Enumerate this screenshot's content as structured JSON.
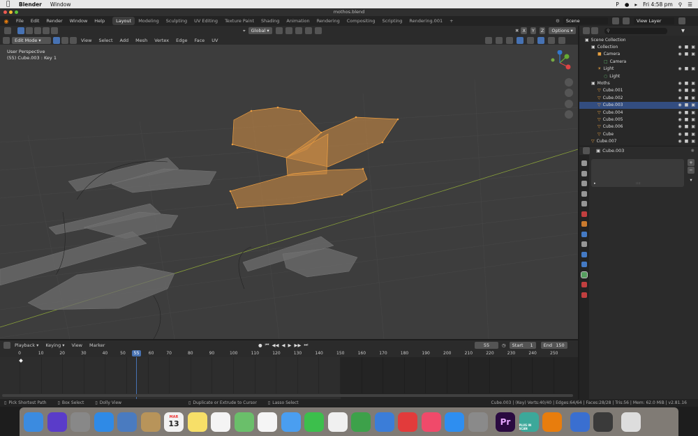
{
  "macos": {
    "app_name": "Blender",
    "menu": [
      "Window"
    ],
    "clock": "Fri 4:58 pm"
  },
  "window": {
    "title": "mothos.blend"
  },
  "topbar": {
    "menus": [
      "File",
      "Edit",
      "Render",
      "Window",
      "Help"
    ],
    "workspaces": [
      "Layout",
      "Modeling",
      "Sculpting",
      "UV Editing",
      "Texture Paint",
      "Shading",
      "Animation",
      "Rendering",
      "Compositing",
      "Scripting",
      "Rendering.001"
    ],
    "active_workspace": "Layout",
    "add_tab": "+",
    "scene_label": "Scene",
    "view_layer_label": "View Layer"
  },
  "viewport_header": {
    "transform_orientation": "Global",
    "options_label": "Options",
    "axes": [
      "X",
      "Y",
      "Z"
    ],
    "mode": "Edit Mode",
    "menus": [
      "View",
      "Select",
      "Add",
      "Mesh",
      "Vertex",
      "Edge",
      "Face",
      "UV"
    ]
  },
  "viewport": {
    "perspective": "User Perspective",
    "object_info": "(55) Cube.003 : Key 1",
    "gizmo": {
      "x": "X",
      "y": "Y",
      "z": "Z"
    },
    "colors": {
      "selected_mesh": "#e89a3a",
      "grid_x_axis": "#8aa23a",
      "background": "#3d3d3d"
    }
  },
  "outliner": {
    "root": "Scene Collection",
    "items": [
      {
        "name": "Collection",
        "indent": 1,
        "icon": "collection-icon"
      },
      {
        "name": "Camera",
        "indent": 2,
        "icon": "camera-icon"
      },
      {
        "name": "Camera",
        "indent": 3,
        "icon": "camera-data-icon"
      },
      {
        "name": "Light",
        "indent": 2,
        "icon": "light-icon"
      },
      {
        "name": "Light",
        "indent": 3,
        "icon": "light-data-icon"
      },
      {
        "name": "Moths",
        "indent": 1,
        "icon": "collection-icon"
      },
      {
        "name": "Cube.001",
        "indent": 2,
        "icon": "mesh-icon"
      },
      {
        "name": "Cube.002",
        "indent": 2,
        "icon": "mesh-icon"
      },
      {
        "name": "Cube.003",
        "indent": 2,
        "icon": "mesh-icon",
        "selected": true
      },
      {
        "name": "Cube.004",
        "indent": 2,
        "icon": "mesh-icon"
      },
      {
        "name": "Cube.005",
        "indent": 2,
        "icon": "mesh-icon"
      },
      {
        "name": "Cube.006",
        "indent": 2,
        "icon": "mesh-icon"
      },
      {
        "name": "Cube",
        "indent": 2,
        "icon": "mesh-icon"
      },
      {
        "name": "Cube.007",
        "indent": 1,
        "icon": "mesh-icon"
      }
    ]
  },
  "properties": {
    "object_name": "Cube.003"
  },
  "timeline": {
    "menus": [
      "Playback",
      "Keying",
      "View",
      "Marker"
    ],
    "current_frame": "55",
    "start_label": "Start",
    "start": "1",
    "end_label": "End",
    "end": "150",
    "ticks": [
      "0",
      "10",
      "20",
      "30",
      "40",
      "50",
      "60",
      "70",
      "80",
      "90",
      "100",
      "110",
      "120",
      "130",
      "140",
      "150",
      "160",
      "170",
      "180",
      "190",
      "200",
      "210",
      "220",
      "230",
      "240",
      "250"
    ]
  },
  "statusbar": {
    "left": [
      {
        "icon": "mouse-left-icon",
        "text": "Pick Shortest Path"
      },
      {
        "icon": "mouse-left-icon",
        "text": "Box Select"
      },
      {
        "icon": "mouse-middle-icon",
        "text": "Dolly View"
      },
      {
        "icon": "mouse-right-icon",
        "text": "Duplicate or Extrude to Cursor"
      },
      {
        "icon": "mouse-right-icon",
        "text": "Lasso Select"
      }
    ],
    "right": "Cube.003 | (Key) Verts:40/40 | Edges:64/64 | Faces:28/28 | Tris:56 | Mem: 62.0 MiB | v2.81.16"
  },
  "dock": {
    "calendar_month": "MAR",
    "calendar_day": "13",
    "apps": [
      {
        "name": "finder-icon",
        "color": "#3b8be0"
      },
      {
        "name": "siri-icon",
        "color": "#5a3cc9"
      },
      {
        "name": "launchpad-icon",
        "color": "#888"
      },
      {
        "name": "safari-icon",
        "color": "#2f8ae6"
      },
      {
        "name": "mail-icon",
        "color": "#4a7bc0"
      },
      {
        "name": "contacts-icon",
        "color": "#b8945a"
      },
      {
        "name": "calendar-icon",
        "color": "#f2f2f2"
      },
      {
        "name": "notes-icon",
        "color": "#f7df68"
      },
      {
        "name": "reminders-icon",
        "color": "#f4f4f4"
      },
      {
        "name": "maps-icon",
        "color": "#6abf6a"
      },
      {
        "name": "photos-icon",
        "color": "#f5f5f5"
      },
      {
        "name": "messages-icon",
        "color": "#4a9ef0"
      },
      {
        "name": "facetime-icon",
        "color": "#3cbf4c"
      },
      {
        "name": "news-icon",
        "color": "#f0f0f0"
      },
      {
        "name": "numbers-icon",
        "color": "#3da14a"
      },
      {
        "name": "keynote-icon",
        "color": "#3b7dd8"
      },
      {
        "name": "block-icon",
        "color": "#e23b3b"
      },
      {
        "name": "music-icon",
        "color": "#f04a6a"
      },
      {
        "name": "app-store-icon",
        "color": "#2e8ef0"
      },
      {
        "name": "system-preferences-icon",
        "color": "#8a8a8a"
      },
      {
        "name": "premiere-icon",
        "color": "#2a0a40"
      },
      {
        "name": "plus-icon",
        "color": "#3ca89a"
      },
      {
        "name": "blender-icon",
        "color": "#e87d0d"
      },
      {
        "name": "globe-icon",
        "color": "#3a6fd0"
      },
      {
        "name": "screenshot-icon",
        "color": "#3a3a3a"
      },
      {
        "name": "trash-icon",
        "color": "#ddd"
      }
    ],
    "premiere_label": "Pr",
    "plus_label": "PLUS IN SCAN"
  }
}
